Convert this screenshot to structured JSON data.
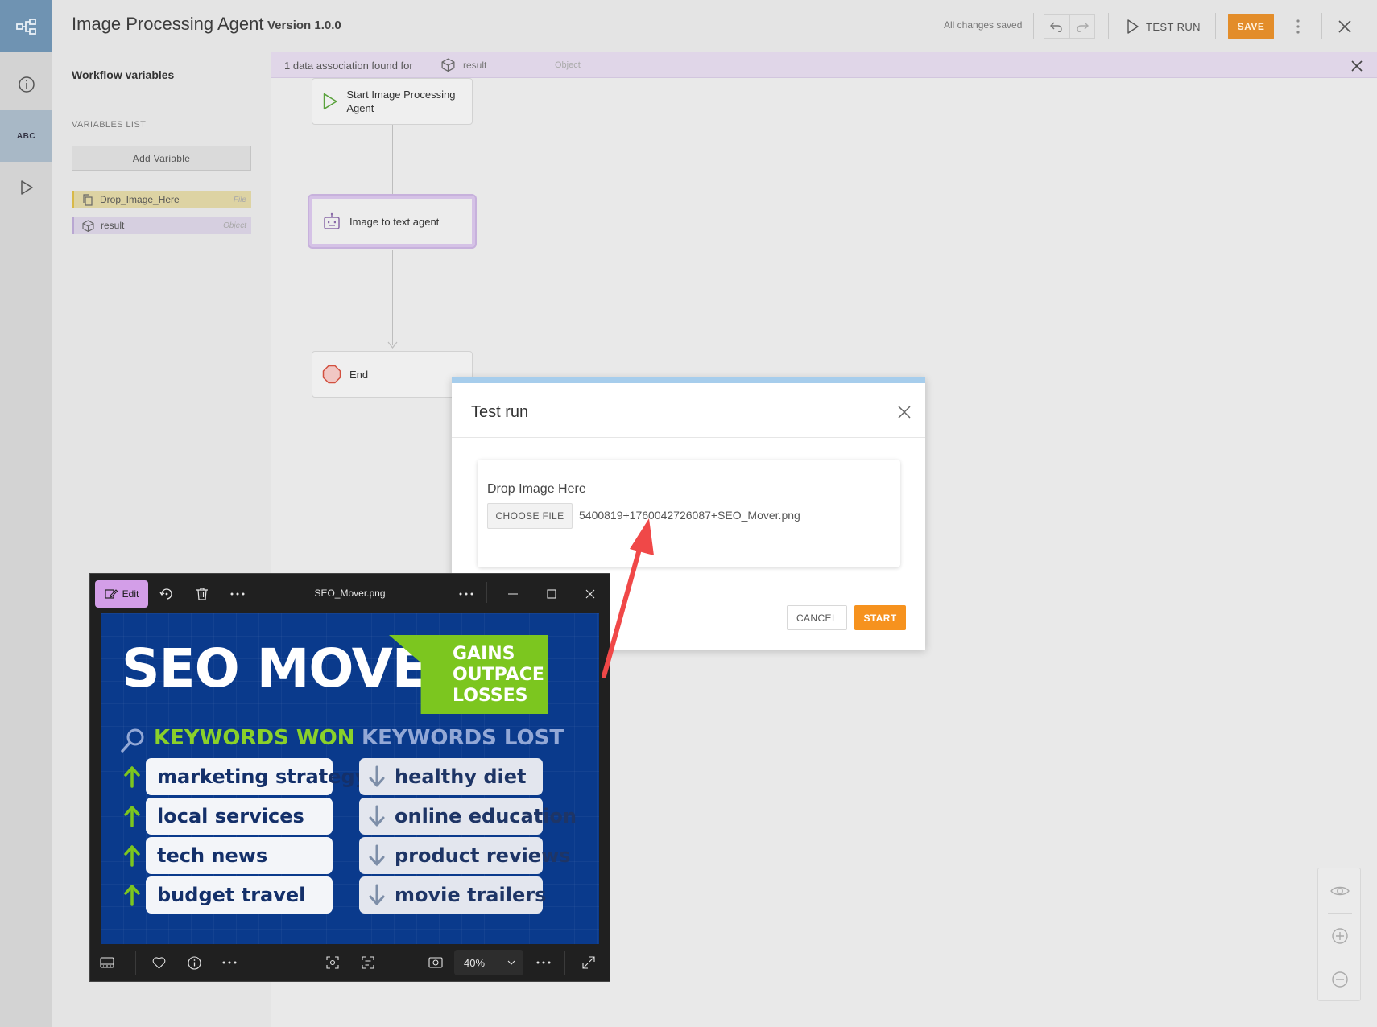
{
  "header": {
    "title": "Image Processing Agent",
    "version": "Version 1.0.0",
    "status": "All changes saved",
    "test_run_label": "TEST RUN",
    "save_label": "SAVE"
  },
  "variables_panel": {
    "title": "Workflow variables",
    "list_label": "VARIABLES LIST",
    "add_label": "Add Variable",
    "items": [
      {
        "name": "Drop_Image_Here",
        "type": "File"
      },
      {
        "name": "result",
        "type": "Object"
      }
    ]
  },
  "rail": {
    "abc_label": "ABC"
  },
  "banner": {
    "text": "1 data association found for",
    "variable": "result",
    "type": "Object"
  },
  "workflow": {
    "nodes": [
      {
        "label": "Start Image Processing Agent"
      },
      {
        "label": "Image to text agent"
      },
      {
        "label": "End"
      }
    ]
  },
  "modal": {
    "title": "Test run",
    "field_label": "Drop Image Here",
    "choose_file_label": "CHOOSE FILE",
    "file_name": "5400819+1760042726087+SEO_Mover.png",
    "cancel_label": "CANCEL",
    "start_label": "START"
  },
  "viewer": {
    "edit_label": "Edit",
    "title": "SEO_Mover.png",
    "zoom": "40%"
  },
  "seo_image": {
    "title": "SEO MOVER",
    "badge_lines": [
      "GAINS",
      "OUTPACE",
      "LOSSES"
    ],
    "won_heading": "KEYWORDS WON",
    "lost_heading": "KEYWORDS LOST",
    "won": [
      "marketing strategy",
      "local services",
      "tech news",
      "budget travel"
    ],
    "lost": [
      "healthy diet",
      "online education",
      "product reviews",
      "movie trailers"
    ]
  },
  "colors": {
    "accent_save": "#e38d2a",
    "accent_start": "#f6921e",
    "banner_bg": "#e0d6e8",
    "seo_blue": "#0a3a8c",
    "seo_green": "#7cc61f",
    "annotation_red": "#f04848"
  }
}
